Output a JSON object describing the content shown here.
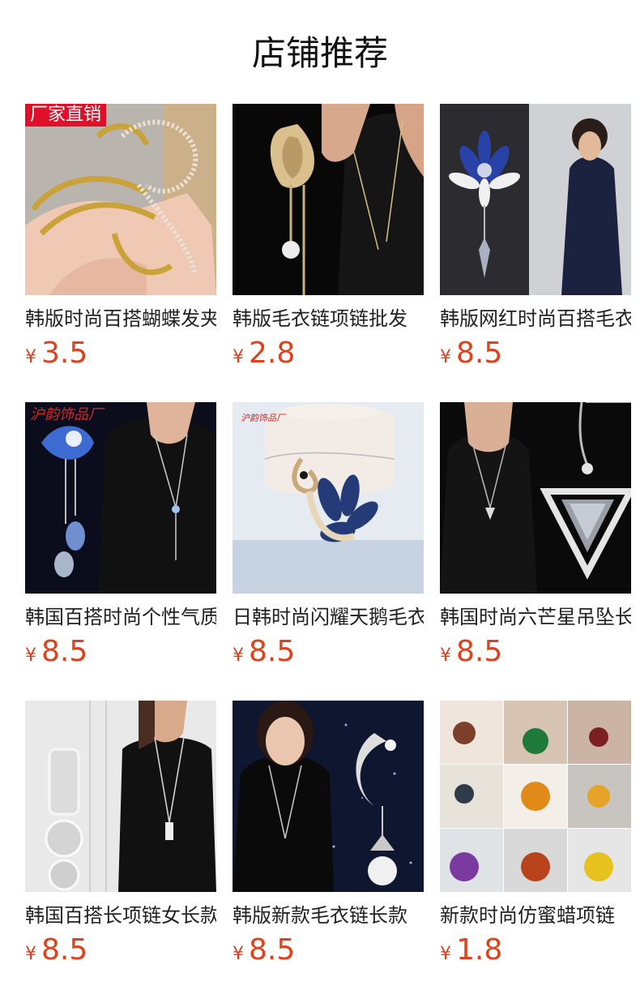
{
  "section_title": "店铺推荐",
  "currency_symbol": "¥",
  "products": [
    {
      "name": "韩版时尚百搭蝴蝶发夹",
      "price": "3.5",
      "image": "hair-claw-clips",
      "badge": "厂家直销"
    },
    {
      "name": "韩版毛衣链项链批发",
      "price": "2.8",
      "image": "tulip-pearl-necklace"
    },
    {
      "name": "韩版网红时尚百搭毛衣链",
      "price": "8.5",
      "image": "blue-crystal-flower-necklace"
    },
    {
      "name": "韩国百搭时尚个性气质",
      "price": "8.5",
      "image": "crystal-fish-necklace",
      "watermark": "沪韵饰品厂"
    },
    {
      "name": "日韩时尚闪耀天鹅毛衣链",
      "price": "8.5",
      "image": "swan-pendant",
      "watermark": "沪韵饰品厂"
    },
    {
      "name": "韩国时尚六芒星吊坠长",
      "price": "8.5",
      "image": "star-pendant"
    },
    {
      "name": "韩国百搭长项链女长款",
      "price": "8.5",
      "image": "crystal-cylinder-necklace"
    },
    {
      "name": "韩版新款毛衣链长款",
      "price": "8.5",
      "image": "moon-pearl-necklace"
    },
    {
      "name": "新款时尚仿蜜蜡项链",
      "price": "1.8",
      "image": "amber-bead-necklace-collage"
    }
  ]
}
